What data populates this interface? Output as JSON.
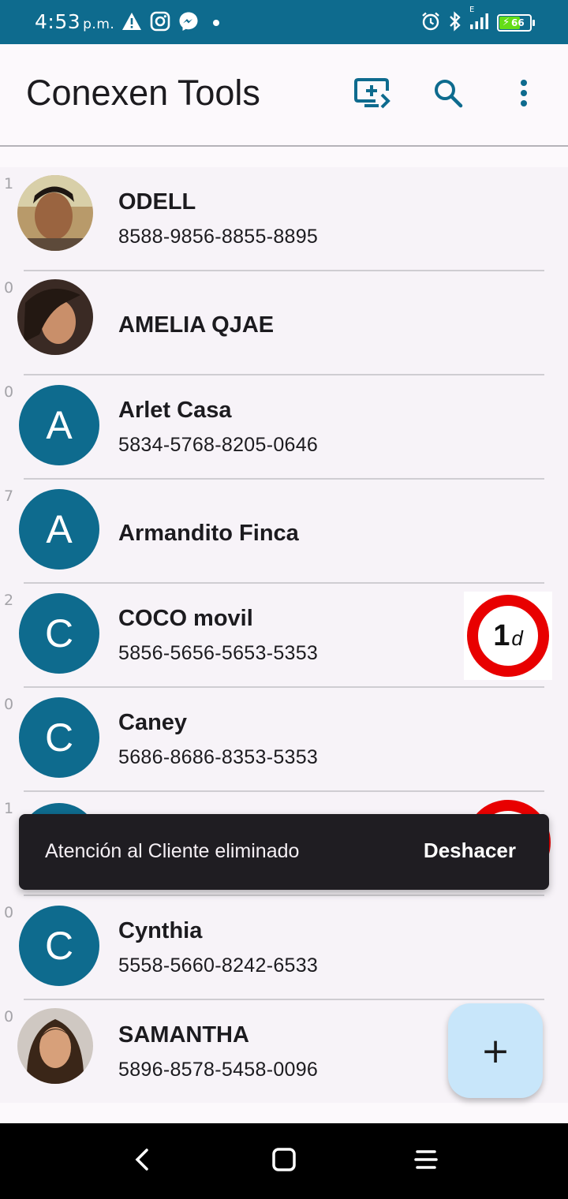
{
  "status_bar": {
    "time": "4:53",
    "ampm": "p.m.",
    "battery_level": "66",
    "network_type": "E"
  },
  "app_bar": {
    "title": "Conexen Tools",
    "actions": [
      "cast-icon",
      "search-icon",
      "more-vert-icon"
    ]
  },
  "contacts": [
    {
      "count": "1",
      "name": "ODELL",
      "phone": "8588-9856-8855-8895",
      "avatar_type": "photo"
    },
    {
      "count": "0",
      "name": "AMELIA QJAE",
      "phone": "",
      "avatar_type": "photo"
    },
    {
      "count": "0",
      "name": "Arlet Casa",
      "phone": "5834-5768-8205-0646",
      "avatar_letter": "A"
    },
    {
      "count": "7",
      "name": "Armandito Finca",
      "phone": "",
      "avatar_letter": "A"
    },
    {
      "count": "2",
      "name": "COCO movil",
      "phone": "5856-5656-5653-5353",
      "avatar_letter": "C",
      "badge": {
        "value": "1",
        "unit": "d"
      }
    },
    {
      "count": "0",
      "name": "Caney",
      "phone": "5686-8686-8353-5353",
      "avatar_letter": "C"
    },
    {
      "count": "1",
      "name": "",
      "phone": "",
      "avatar_letter": ""
    },
    {
      "count": "0",
      "name": "Cynthia",
      "phone": "5558-5660-8242-6533",
      "avatar_letter": "C"
    },
    {
      "count": "0",
      "name": "SAMANTHA",
      "phone": "5896-8578-5458-0096",
      "avatar_type": "photo"
    }
  ],
  "snackbar": {
    "message": "Atención al Cliente eliminado",
    "action": "Deshacer"
  },
  "fab": {
    "label": "+"
  },
  "colors": {
    "primary": "#0e6b8e",
    "badge_ring": "#e80000",
    "fab_bg": "#c8e6fa",
    "snackbar_bg": "#1f1d22"
  }
}
